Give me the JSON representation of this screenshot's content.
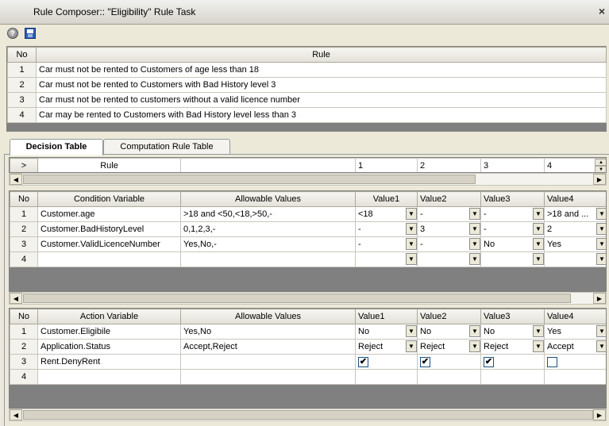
{
  "window": {
    "title": "Rule Composer:: \"Eligibility\" Rule Task",
    "close": "×"
  },
  "toolbar": {
    "help": "?",
    "save": ""
  },
  "rules": {
    "headers": {
      "no": "No",
      "rule": "Rule"
    },
    "rows": [
      {
        "no": "1",
        "text": "Car must not be rented to Customers of age less than 18"
      },
      {
        "no": "2",
        "text": "Car must not be rented to Customers with Bad History level 3"
      },
      {
        "no": "3",
        "text": "Car must not be rented to customers without a valid licence number"
      },
      {
        "no": "4",
        "text": "Car may be rented to Customers with Bad History level less than 3"
      }
    ]
  },
  "tabs": {
    "decision": "Decision Table",
    "computation": "Computation Rule Table"
  },
  "ruleHeader": {
    "marker": ">",
    "label": "Rule",
    "cols": [
      "1",
      "2",
      "3",
      "4"
    ]
  },
  "conditions": {
    "headers": {
      "no": "No",
      "var": "Condition Variable",
      "allowed": "Allowable Values",
      "v1": "Value1",
      "v2": "Value2",
      "v3": "Value3",
      "v4": "Value4"
    },
    "rows": [
      {
        "no": "1",
        "var": "Customer.age",
        "allowed": ">18 and <50,<18,>50,-",
        "v1": "<18",
        "v2": "-",
        "v3": "-",
        "v4": ">18 and ..."
      },
      {
        "no": "2",
        "var": "Customer.BadHistoryLevel",
        "allowed": "0,1,2,3,-",
        "v1": "-",
        "v2": "3",
        "v3": "-",
        "v4": "2"
      },
      {
        "no": "3",
        "var": "Customer.ValidLicenceNumber",
        "allowed": "Yes,No,-",
        "v1": "-",
        "v2": "-",
        "v3": "No",
        "v4": "Yes"
      },
      {
        "no": "4",
        "var": "",
        "allowed": "",
        "v1": "",
        "v2": "",
        "v3": "",
        "v4": ""
      }
    ]
  },
  "actions": {
    "headers": {
      "no": "No",
      "var": "Action Variable",
      "allowed": "Allowable Values",
      "v1": "Value1",
      "v2": "Value2",
      "v3": "Value3",
      "v4": "Value4"
    },
    "rows": [
      {
        "no": "1",
        "var": "Customer.Eligibile",
        "allowed": "Yes,No",
        "v1": "No",
        "v2": "No",
        "v3": "No",
        "v4": "Yes"
      },
      {
        "no": "2",
        "var": "Application.Status",
        "allowed": "Accept,Reject",
        "v1": "Reject",
        "v2": "Reject",
        "v3": "Reject",
        "v4": "Accept"
      },
      {
        "no": "3",
        "var": "Rent.DenyRent",
        "allowed": "",
        "checks": [
          true,
          true,
          true,
          false
        ]
      },
      {
        "no": "4",
        "var": "",
        "allowed": ""
      }
    ]
  },
  "check_mark": "✔",
  "icons": {
    "dropdown": "▼",
    "left": "◀",
    "right": "▶",
    "up": "▲",
    "down": "▼"
  }
}
